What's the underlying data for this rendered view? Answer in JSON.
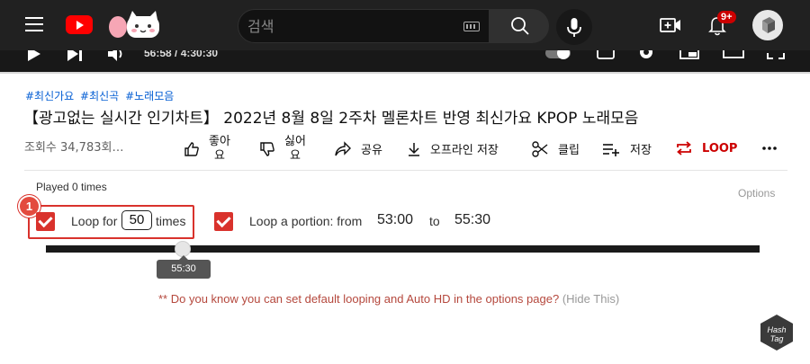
{
  "header": {
    "search_placeholder": "검색",
    "notification_count": "9+"
  },
  "player": {
    "time_display": "56:58 / 4:30:30"
  },
  "video": {
    "hashtags": [
      "#최신가요",
      "#최신곡",
      "#노래모음"
    ],
    "title": "【광고없는 실시간 인기차트】 2022년 8월 8일 2주차 멜론차트 반영 최신가요 KPOP 노래모음",
    "views": "조회수 34,783회…",
    "actions": {
      "like_line1": "좋아",
      "like_line2": "요",
      "dislike_line1": "싫어",
      "dislike_line2": "요",
      "share": "공유",
      "offline_save": "오프라인 저장",
      "clip": "클립",
      "save": "저장",
      "loop": "LOOP"
    }
  },
  "looper": {
    "played": "Played 0 times",
    "options": "Options",
    "step_number": "1",
    "loop_for_label": "Loop for",
    "loop_count": "50",
    "times_label": "times",
    "portion_label": "Loop a portion: from",
    "from_time": "53:00",
    "to_label": "to",
    "to_time": "55:30",
    "handle_tooltip": "55:30",
    "loop_for_checked": true,
    "portion_checked": true,
    "slider_position_fraction": 0.18
  },
  "note": {
    "text": "** Do you know you can set default looping and Auto HD in the options page?",
    "hide_link": "(Hide This)"
  },
  "colors": {
    "accent_red": "#d9322c",
    "youtube_red": "#ff0000",
    "hashtag_blue": "#065fd4"
  }
}
